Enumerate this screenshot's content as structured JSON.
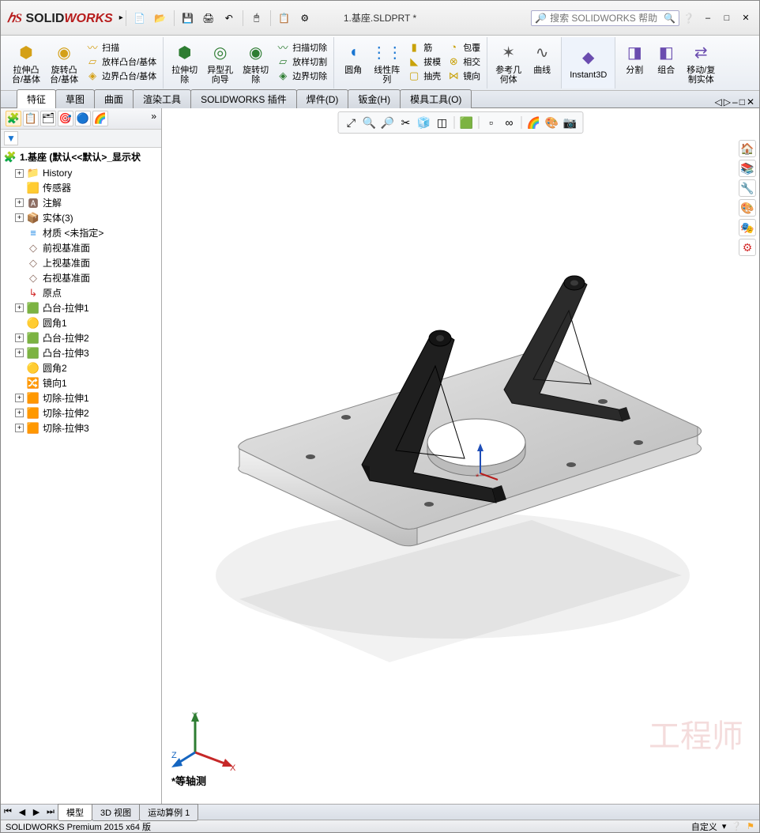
{
  "app": {
    "name_a": "S",
    "name_b": "SOLID",
    "name_c": "WORKS"
  },
  "title": "1.基座.SLDPRT *",
  "search": {
    "placeholder": "搜索 SOLIDWORKS 帮助"
  },
  "ribbon": {
    "g1": {
      "btn1": "拉伸凸\n台/基体",
      "btn2": "旋转凸\n台/基体",
      "s1": "扫描",
      "s2": "放样凸台/基体",
      "s3": "边界凸台/基体"
    },
    "g2": {
      "btn1": "拉伸切\n除",
      "btn2": "异型孔\n向导",
      "btn3": "旋转切\n除",
      "s1": "扫描切除",
      "s2": "放样切割",
      "s3": "边界切除"
    },
    "g3": {
      "btn1": "圆角",
      "btn2": "线性阵\n列",
      "s1": "筋",
      "s2": "拔模",
      "s3": "抽壳",
      "s4": "包覆",
      "s5": "相交",
      "s6": "镜向"
    },
    "g4": {
      "btn1": "参考几\n何体",
      "btn2": "曲线"
    },
    "g5": {
      "btn1": "Instant3D"
    },
    "g6": {
      "btn1": "分割",
      "btn2": "组合",
      "btn3": "移动/复\n制实体"
    }
  },
  "tabs": [
    "特征",
    "草图",
    "曲面",
    "渲染工具",
    "SOLIDWORKS 插件",
    "焊件(D)",
    "钣金(H)",
    "模具工具(O)"
  ],
  "tree": {
    "root": "1.基座  (默认<<默认>_显示状",
    "items": [
      {
        "ico": "📁",
        "txt": "History",
        "exp": "+"
      },
      {
        "ico": "🟨",
        "txt": "传感器"
      },
      {
        "ico": "🅰",
        "txt": "注解",
        "exp": "+"
      },
      {
        "ico": "📦",
        "txt": "实体(3)",
        "exp": "+"
      },
      {
        "ico": "≡",
        "txt": "材质 <未指定>",
        "color": "#1e88e5"
      },
      {
        "ico": "◇",
        "txt": "前视基准面"
      },
      {
        "ico": "◇",
        "txt": "上视基准面"
      },
      {
        "ico": "◇",
        "txt": "右视基准面"
      },
      {
        "ico": "↳",
        "txt": "原点",
        "color": "#d32f2f"
      },
      {
        "ico": "🟩",
        "txt": "凸台-拉伸1",
        "exp": "+"
      },
      {
        "ico": "🟡",
        "txt": "圆角1"
      },
      {
        "ico": "🟩",
        "txt": "凸台-拉伸2",
        "exp": "+"
      },
      {
        "ico": "🟩",
        "txt": "凸台-拉伸3",
        "exp": "+"
      },
      {
        "ico": "🟡",
        "txt": "圆角2"
      },
      {
        "ico": "🔀",
        "txt": "镜向1"
      },
      {
        "ico": "🟧",
        "txt": "切除-拉伸1",
        "exp": "+"
      },
      {
        "ico": "🟧",
        "txt": "切除-拉伸2",
        "exp": "+"
      },
      {
        "ico": "🟧",
        "txt": "切除-拉伸3",
        "exp": "+"
      }
    ]
  },
  "view_label": "*等轴测",
  "bottom_tabs": [
    "模型",
    "3D 视图",
    "运动算例 1"
  ],
  "status": {
    "left": "SOLIDWORKS Premium 2015 x64 版",
    "right": "自定义"
  },
  "watermark": "工程师"
}
